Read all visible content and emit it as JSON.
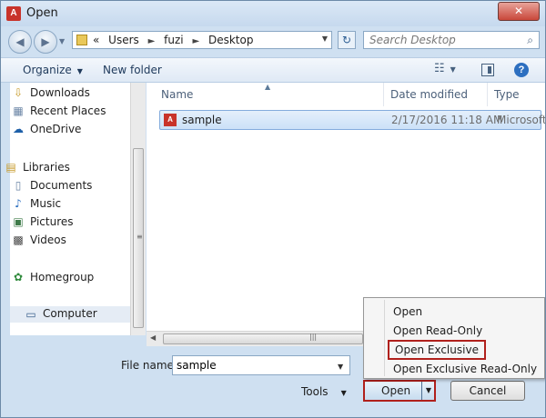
{
  "window": {
    "title": "Open",
    "title_icon": "A",
    "close_glyph": "✕"
  },
  "nav": {
    "back_glyph": "◀",
    "forward_glyph": "▶",
    "path": [
      "«",
      "Users",
      "fuzi",
      "Desktop"
    ],
    "separator": "►",
    "refresh_glyph": "↻",
    "search_placeholder": "Search Desktop",
    "search_glyph": "⌕"
  },
  "toolbar": {
    "organize": "Organize",
    "new_folder": "New folder",
    "views_glyph": "☷",
    "help_glyph": "?"
  },
  "sidebar": {
    "items": [
      {
        "label": "Downloads",
        "icon": "⇩"
      },
      {
        "label": "Recent Places",
        "icon": "▦"
      },
      {
        "label": "OneDrive",
        "icon": "☁"
      },
      {
        "label": "Libraries",
        "icon": "▤"
      },
      {
        "label": "Documents",
        "icon": "▯"
      },
      {
        "label": "Music",
        "icon": "♪"
      },
      {
        "label": "Pictures",
        "icon": "▣"
      },
      {
        "label": "Videos",
        "icon": "▩"
      },
      {
        "label": "Homegroup",
        "icon": "✿"
      },
      {
        "label": "Computer",
        "icon": "▭"
      }
    ]
  },
  "columns": {
    "name": "Name",
    "date": "Date modified",
    "type": "Type"
  },
  "files": [
    {
      "name": "sample",
      "date": "2/17/2016 11:18 AM",
      "type": "Microsoft",
      "icon": "A"
    }
  ],
  "bottom": {
    "filename_label": "File name:",
    "filename_value": "sample",
    "tools_label": "Tools",
    "open_label": "Open",
    "cancel_label": "Cancel"
  },
  "open_menu": {
    "items": [
      "Open",
      "Open Read-Only",
      "Open Exclusive",
      "Open Exclusive Read-Only"
    ],
    "highlighted_index": 2
  },
  "colors": {
    "highlight_border": "#b0201c",
    "access_red": "#c8332a"
  }
}
